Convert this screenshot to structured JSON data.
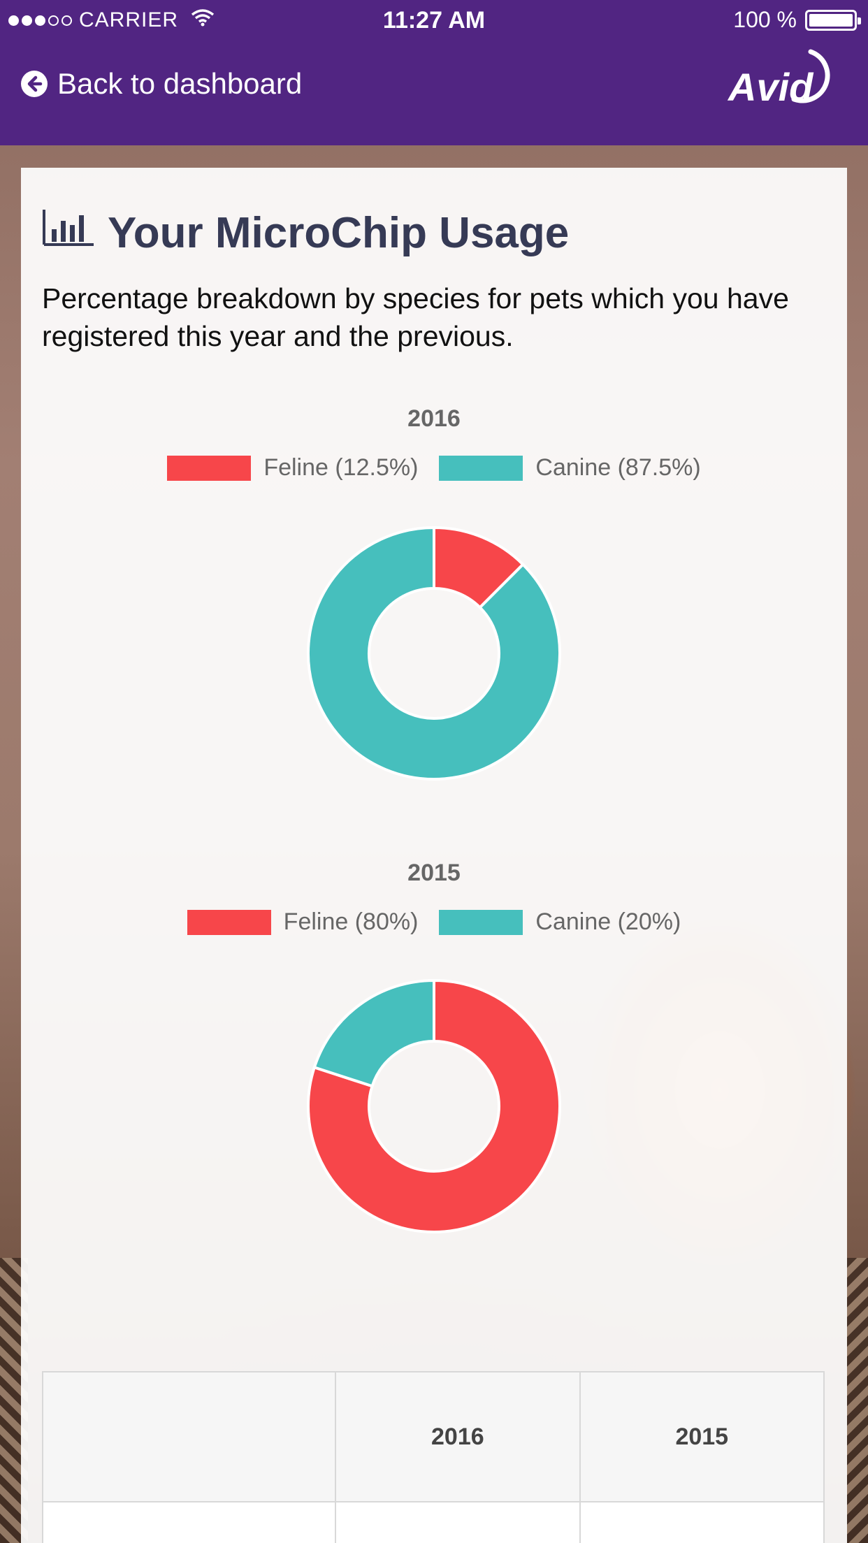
{
  "status_bar": {
    "carrier": "CARRIER",
    "time": "11:27 AM",
    "battery": "100 %"
  },
  "header": {
    "back_label": "Back to dashboard",
    "logo_text": "Avid"
  },
  "card": {
    "title": "Your MicroChip Usage",
    "description": "Percentage breakdown by species for pets which you have registered this year and the previous."
  },
  "colors": {
    "header": "#512582",
    "feline": "#f7464a",
    "canine": "#46bfbd"
  },
  "chart_data": [
    {
      "type": "pie",
      "title": "2016",
      "categories": [
        "Feline (12.5%)",
        "Canine (87.5%)"
      ],
      "values": [
        12.5,
        87.5
      ],
      "colors": [
        "#f7464a",
        "#46bfbd"
      ],
      "legend": "top"
    },
    {
      "type": "pie",
      "title": "2015",
      "categories": [
        "Feline (80%)",
        "Canine (20%)"
      ],
      "values": [
        80,
        20
      ],
      "colors": [
        "#f7464a",
        "#46bfbd"
      ],
      "legend": "top"
    }
  ],
  "table": {
    "headers": [
      "",
      "2016",
      "2015"
    ]
  }
}
